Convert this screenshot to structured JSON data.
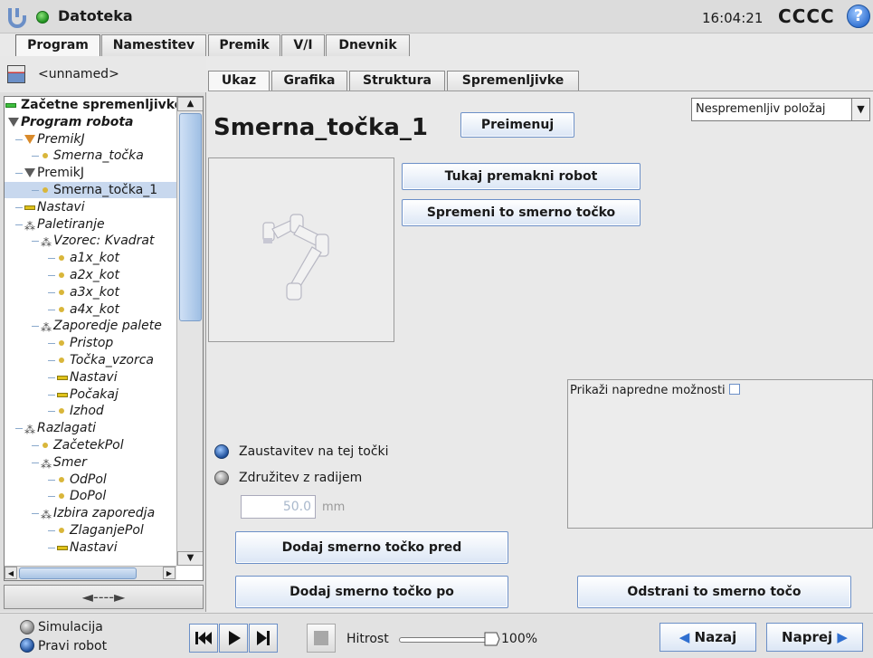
{
  "header": {
    "title": "Datoteka",
    "clock": "16:04:21",
    "robot_name": "CCCC",
    "help": "?"
  },
  "main_tabs": [
    {
      "label": "Program",
      "active": true
    },
    {
      "label": "Namestitev",
      "active": false
    },
    {
      "label": "Premik",
      "active": false
    },
    {
      "label": "V/I",
      "active": false
    },
    {
      "label": "Dnevnik",
      "active": false
    }
  ],
  "program": {
    "name": "<unnamed>"
  },
  "tree": {
    "nodes": [
      {
        "label": "Začetne spremenljivke",
        "depth": 0,
        "icon": "bar-green",
        "style": "bold"
      },
      {
        "label": "Program robota",
        "depth": 0,
        "icon": "triangle-gray",
        "style": "bold-italic"
      },
      {
        "label": "PremikJ",
        "depth": 1,
        "icon": "triangle-orange",
        "style": "italic"
      },
      {
        "label": "Smerna_točka",
        "depth": 2,
        "icon": "dot",
        "style": "italic"
      },
      {
        "label": "PremikJ",
        "depth": 1,
        "icon": "triangle-gray",
        "style": "normal"
      },
      {
        "label": "Smerna_točka_1",
        "depth": 2,
        "icon": "dot",
        "style": "normal",
        "selected": true
      },
      {
        "label": "Nastavi",
        "depth": 1,
        "icon": "bar-yellow",
        "style": "italic"
      },
      {
        "label": "Paletiranje",
        "depth": 1,
        "icon": "pallet",
        "style": "italic"
      },
      {
        "label": "Vzorec: Kvadrat",
        "depth": 2,
        "icon": "pallet",
        "style": "italic"
      },
      {
        "label": "a1x_kot",
        "depth": 3,
        "icon": "dot",
        "style": "italic"
      },
      {
        "label": "a2x_kot",
        "depth": 3,
        "icon": "dot",
        "style": "italic"
      },
      {
        "label": "a3x_kot",
        "depth": 3,
        "icon": "dot",
        "style": "italic"
      },
      {
        "label": "a4x_kot",
        "depth": 3,
        "icon": "dot",
        "style": "italic"
      },
      {
        "label": "Zaporedje palete",
        "depth": 2,
        "icon": "pallet",
        "style": "italic"
      },
      {
        "label": "Pristop",
        "depth": 3,
        "icon": "dot",
        "style": "italic"
      },
      {
        "label": "Točka_vzorca",
        "depth": 3,
        "icon": "dot",
        "style": "italic"
      },
      {
        "label": "Nastavi",
        "depth": 3,
        "icon": "bar-yellow",
        "style": "italic"
      },
      {
        "label": "Počakaj",
        "depth": 3,
        "icon": "bar-yellow",
        "style": "italic"
      },
      {
        "label": "Izhod",
        "depth": 3,
        "icon": "dot",
        "style": "italic"
      },
      {
        "label": "Razlagati",
        "depth": 1,
        "icon": "pallet",
        "style": "italic"
      },
      {
        "label": "ZačetekPol",
        "depth": 2,
        "icon": "dot",
        "style": "italic"
      },
      {
        "label": "Smer",
        "depth": 2,
        "icon": "pallet",
        "style": "italic"
      },
      {
        "label": "OdPol",
        "depth": 3,
        "icon": "dot",
        "style": "italic"
      },
      {
        "label": "DoPol",
        "depth": 3,
        "icon": "dot",
        "style": "italic"
      },
      {
        "label": "Izbira zaporedja",
        "depth": 2,
        "icon": "pallet",
        "style": "italic"
      },
      {
        "label": "ZlaganjePol",
        "depth": 3,
        "icon": "dot",
        "style": "italic"
      },
      {
        "label": "Nastavi",
        "depth": 3,
        "icon": "bar-yellow",
        "style": "italic"
      }
    ],
    "nav_arrow": "◄----►"
  },
  "sub_tabs": [
    {
      "label": "Ukaz",
      "active": true
    },
    {
      "label": "Grafika",
      "active": false
    },
    {
      "label": "Struktura",
      "active": false
    },
    {
      "label": "Spremenljivke",
      "active": false
    }
  ],
  "command": {
    "waypoint_title": "Smerna_točka_1",
    "rename_button": "Preimenuj",
    "position_dropdown": "Nespremenljiv položaj",
    "move_here_button": "Tukaj premakni robot",
    "change_waypoint_button": "Spremeni to smerno točko",
    "advanced_label": "Prikaži napredne možnosti",
    "stop_at_point": "Zaustavitev na tej točki",
    "blend_with_radius": "Združitev z radijem",
    "radius_value": "50.0",
    "radius_unit": "mm",
    "add_before_button": "Dodaj smerno točko pred",
    "add_after_button": "Dodaj smerno točko po",
    "remove_button": "Odstrani to smerno točo"
  },
  "footer": {
    "simulation_label": "Simulacija",
    "real_robot_label": "Pravi robot",
    "speed_label": "Hitrost",
    "speed_value": "100%",
    "speed_fraction": 1.0,
    "back_button": "Nazaj",
    "next_button": "Naprej"
  },
  "colors": {
    "accent": "#2f6fd0",
    "selection": "#c8d8ee",
    "button_border": "#6b8fc7"
  }
}
